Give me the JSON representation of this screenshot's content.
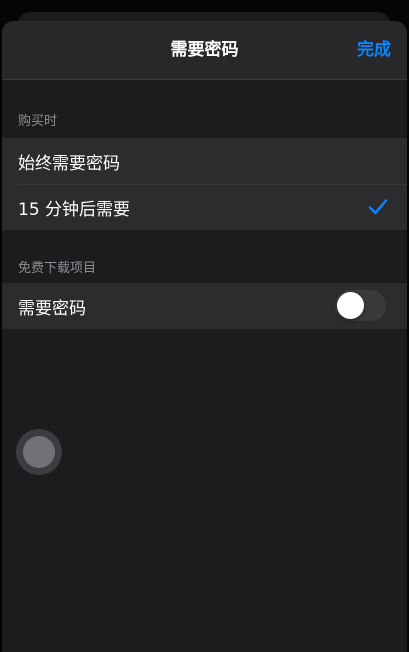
{
  "nav": {
    "title": "需要密码",
    "done_label": "完成"
  },
  "sections": [
    {
      "header": "购买时",
      "rows": [
        {
          "label": "始终需要密码",
          "selected": false
        },
        {
          "label": "15 分钟后需要",
          "selected": true
        }
      ]
    },
    {
      "header": "免费下载项目",
      "rows": [
        {
          "label": "需要密码",
          "toggle_on": false
        }
      ]
    }
  ],
  "colors": {
    "accent": "#0a84ff",
    "sheet_background": "#1c1c1e",
    "cell_background": "#2c2c2e",
    "secondary_text": "#8e8e93"
  },
  "icons": {
    "selected_row": "checkmark-icon",
    "floating_button": "assistive-touch-icon"
  }
}
